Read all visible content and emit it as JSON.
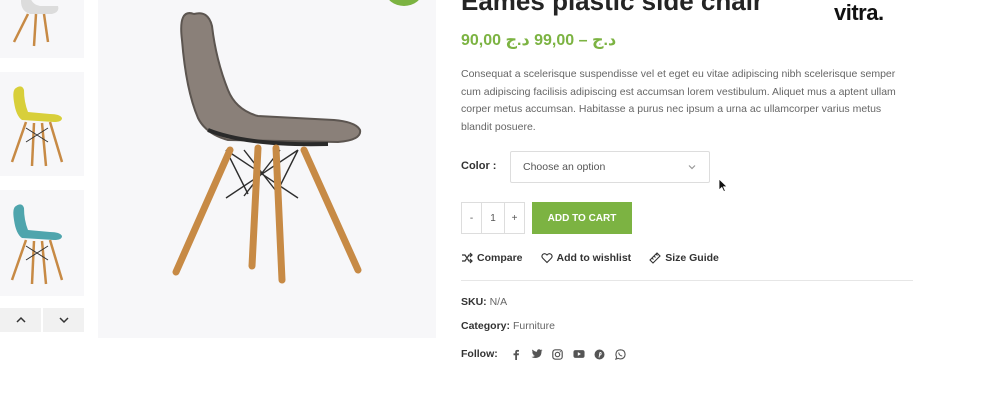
{
  "product": {
    "title": "Eames plastic side chair",
    "brand": "vitra.",
    "price": "90,00 د.ج – 99,00 د.ج",
    "description": "Consequat a scelerisque suspendisse vel et eget eu vitae adipiscing nibh scelerisque semper cum adipiscing facilisis adipiscing est accumsan lorem vestibulum. Aliquet mus a aptent ullam corper metus accumsan. Habitasse a purus nec ipsum a urna ac ullamcorper varius metus blandit posuere."
  },
  "variation": {
    "label": "Color :",
    "placeholder": "Choose an option"
  },
  "cart": {
    "minus": "-",
    "quantity": "1",
    "plus": "+",
    "add_label": "ADD TO CART"
  },
  "actions": {
    "compare": "Compare",
    "wishlist": "Add to wishlist",
    "size_guide": "Size Guide"
  },
  "meta": {
    "sku_label": "SKU:",
    "sku_value": "N/A",
    "category_label": "Category:",
    "category_value": "Furniture",
    "follow_label": "Follow:"
  },
  "colors": {
    "accent": "#7cb342",
    "chair_taupe": "#8a8079",
    "chair_yellow": "#d8cf3a",
    "chair_teal": "#4fa5ad",
    "wood": "#c78a45"
  },
  "icons": {
    "social": [
      "facebook-icon",
      "twitter-icon",
      "instagram-icon",
      "youtube-icon",
      "pinterest-icon",
      "whatsapp-icon"
    ]
  }
}
